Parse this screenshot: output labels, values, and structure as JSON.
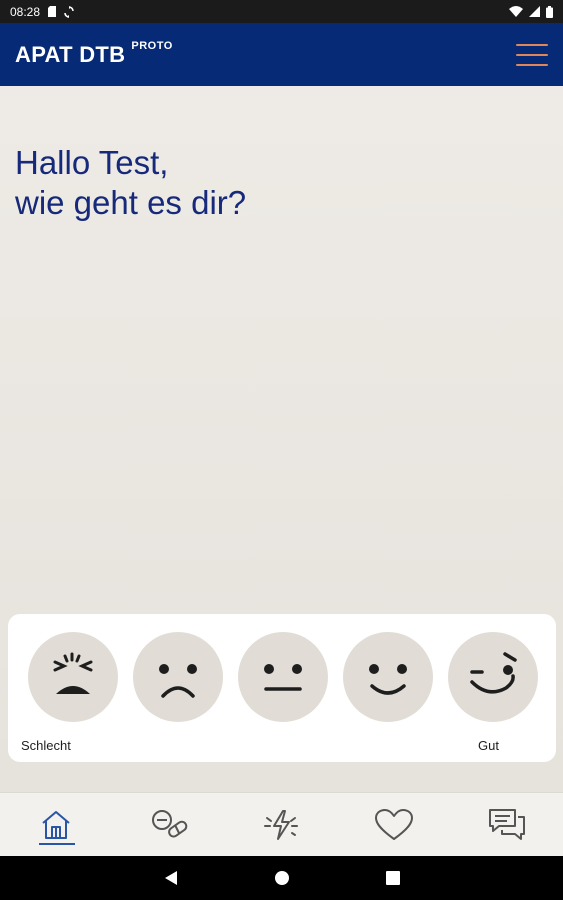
{
  "status_bar": {
    "time": "08:28",
    "icons": [
      "sd-card-icon",
      "sync-icon",
      "wifi-icon",
      "signal-icon",
      "battery-icon"
    ]
  },
  "app_bar": {
    "title": "APAT DTB",
    "badge": "PROTO",
    "menu_icon": "hamburger-menu-icon",
    "menu_color": "#e0875a",
    "background": "#062a75"
  },
  "greeting": {
    "line1": "Hallo Test,",
    "line2": "wie geht es dir?",
    "color": "#16297a"
  },
  "mood_scale": {
    "options": [
      {
        "name": "mood-very-bad",
        "icon": "angry-face-icon"
      },
      {
        "name": "mood-bad",
        "icon": "sad-face-icon"
      },
      {
        "name": "mood-neutral",
        "icon": "neutral-face-icon"
      },
      {
        "name": "mood-good",
        "icon": "smile-face-icon"
      },
      {
        "name": "mood-very-good",
        "icon": "wink-face-icon"
      }
    ],
    "label_left": "Schlecht",
    "label_right": "Gut"
  },
  "bottom_nav": {
    "items": [
      {
        "name": "nav-home",
        "icon": "home-icon",
        "active": true
      },
      {
        "name": "nav-medication",
        "icon": "pills-icon",
        "active": false
      },
      {
        "name": "nav-symptoms",
        "icon": "lightning-icon",
        "active": false
      },
      {
        "name": "nav-wellbeing",
        "icon": "heart-icon",
        "active": false
      },
      {
        "name": "nav-chat",
        "icon": "chat-icon",
        "active": false
      }
    ],
    "active_color": "#2855a6"
  },
  "system_nav": {
    "icons": [
      "back-icon",
      "home-circle-icon",
      "recents-icon"
    ]
  }
}
